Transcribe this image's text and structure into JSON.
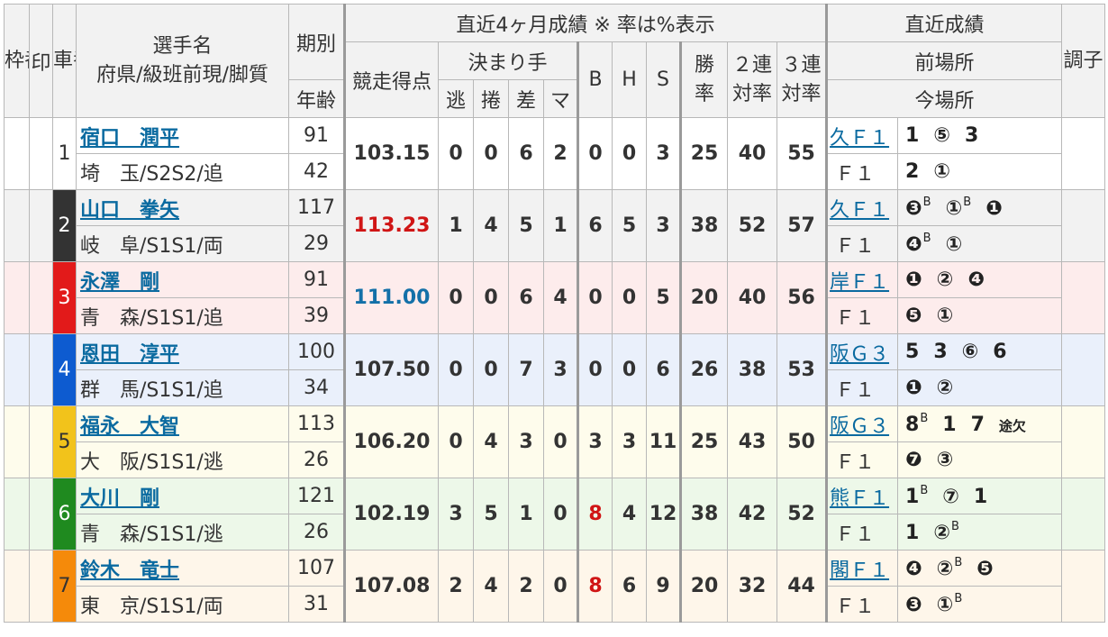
{
  "header": {
    "waku": "枠番",
    "shirushi": "印",
    "sha": "車番",
    "name_line1": "選手名",
    "name_line2": "府県/級班前現/脚質",
    "kibetsu": "期別",
    "age": "年齢",
    "recent_group": "直近4ヶ月成績 ※ 率は%表示",
    "score": "競走得点",
    "kimarite": "決まり手",
    "nige": "逃",
    "makuri": "捲",
    "sashi": "差",
    "ma": "マ",
    "B": "B",
    "H": "H",
    "S": "S",
    "win1": "勝",
    "win2": "率",
    "ren2_1": "２連",
    "ren2_2": "対率",
    "ren3_1": "３連",
    "ren3_2": "対率",
    "recent_results": "直近成績",
    "prev_venue": "前場所",
    "cur_venue": "今場所",
    "choshi": "調子"
  },
  "riders": [
    {
      "car": "1",
      "name": "宿口　潤平",
      "pref": "埼　玉/S2S2/追",
      "ki": "91",
      "age": "42",
      "score": "103.15",
      "score_color": "",
      "nige": "0",
      "makuri": "0",
      "sashi": "6",
      "ma": "2",
      "B": "0",
      "H": "0",
      "S": "3",
      "win": "25",
      "ren2": "40",
      "ren3": "55",
      "prev_venue": "久Ｆ１",
      "prev_res": [
        "1",
        "⑤",
        "3"
      ],
      "cur_venue": "Ｆ１",
      "cur_res": [
        "2",
        "①"
      ]
    },
    {
      "car": "2",
      "name": "山口　拳矢",
      "pref": "岐　阜/S1S1/両",
      "ki": "117",
      "age": "29",
      "score": "113.23",
      "score_color": "red",
      "nige": "1",
      "makuri": "4",
      "sashi": "5",
      "ma": "1",
      "B": "6",
      "H": "5",
      "S": "3",
      "win": "38",
      "ren2": "52",
      "ren3": "57",
      "prev_venue": "久Ｆ１",
      "prev_res": [
        "❸B",
        "①B",
        "❶"
      ],
      "cur_venue": "Ｆ１",
      "cur_res": [
        "❹B",
        "①"
      ]
    },
    {
      "car": "3",
      "name": "永澤　剛",
      "pref": "青　森/S1S1/追",
      "ki": "91",
      "age": "39",
      "score": "111.00",
      "score_color": "blue",
      "nige": "0",
      "makuri": "0",
      "sashi": "6",
      "ma": "4",
      "B": "0",
      "H": "0",
      "S": "5",
      "win": "20",
      "ren2": "40",
      "ren3": "56",
      "prev_venue": "岸Ｆ１",
      "prev_res": [
        "❶",
        "②",
        "❹"
      ],
      "cur_venue": "Ｆ１",
      "cur_res": [
        "❺",
        "①"
      ]
    },
    {
      "car": "4",
      "name": "恩田　淳平",
      "pref": "群　馬/S1S1/追",
      "ki": "100",
      "age": "34",
      "score": "107.50",
      "score_color": "",
      "nige": "0",
      "makuri": "0",
      "sashi": "7",
      "ma": "3",
      "B": "0",
      "H": "0",
      "S": "6",
      "win": "26",
      "ren2": "38",
      "ren3": "53",
      "prev_venue": "阪Ｇ３",
      "prev_res": [
        "5",
        "3",
        "⑥",
        "6"
      ],
      "cur_venue": "Ｆ１",
      "cur_res": [
        "❶",
        "②"
      ]
    },
    {
      "car": "5",
      "name": "福永　大智",
      "pref": "大　阪/S1S1/逃",
      "ki": "113",
      "age": "26",
      "score": "106.20",
      "score_color": "",
      "nige": "0",
      "makuri": "4",
      "sashi": "3",
      "ma": "0",
      "B": "3",
      "H": "3",
      "S": "11",
      "win": "25",
      "ren2": "43",
      "ren3": "50",
      "prev_venue": "阪Ｇ３",
      "prev_res": [
        "8B",
        "1",
        "7",
        "途欠"
      ],
      "cur_venue": "Ｆ１",
      "cur_res": [
        "❼",
        "③"
      ]
    },
    {
      "car": "6",
      "name": "大川　剛",
      "pref": "青　森/S1S1/逃",
      "ki": "121",
      "age": "26",
      "score": "102.19",
      "score_color": "",
      "nige": "3",
      "makuri": "5",
      "sashi": "1",
      "ma": "0",
      "B": "8",
      "B_color": "red",
      "H": "4",
      "S": "12",
      "win": "38",
      "ren2": "42",
      "ren3": "52",
      "prev_venue": "熊Ｆ１",
      "prev_res": [
        "1B",
        "⑦",
        "1"
      ],
      "cur_venue": "Ｆ１",
      "cur_res": [
        "1",
        "②B"
      ]
    },
    {
      "car": "7",
      "name": "鈴木　竜士",
      "pref": "東　京/S1S1/両",
      "ki": "107",
      "age": "31",
      "score": "107.08",
      "score_color": "",
      "nige": "2",
      "makuri": "4",
      "sashi": "2",
      "ma": "0",
      "B": "8",
      "B_color": "red",
      "H": "6",
      "S": "9",
      "win": "20",
      "ren2": "32",
      "ren3": "44",
      "prev_venue": "閣Ｆ１",
      "prev_res": [
        "❹",
        "②B",
        "❺"
      ],
      "cur_venue": "Ｆ１",
      "cur_res": [
        "❸",
        "①B"
      ]
    }
  ]
}
